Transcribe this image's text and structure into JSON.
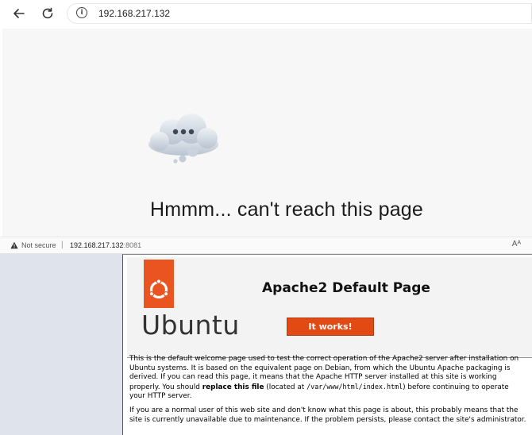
{
  "browser": {
    "url": "192.168.217.132",
    "back_icon": "back-arrow-icon",
    "refresh_icon": "refresh-icon",
    "info_icon": "site-info-icon",
    "info_glyph": "i"
  },
  "error_page": {
    "title": "Hmmm... can't reach this page",
    "illustration_icon": "cloud-error-icon"
  },
  "status_bar": {
    "security_label": "Not secure",
    "separator": "|",
    "host": "192.168.217.132",
    "port": ":8081",
    "read_aloud_label": "Aᴬ"
  },
  "apache_page": {
    "logo_word": "Ubuntu",
    "title": "Apache2 Default Page",
    "banner": "It works!",
    "p1_a": "This is the default welcome page used to test the correct operation of the Apache2 server after installation on Ubuntu systems. It is based on the equivalent page on Debian, from which the Ubuntu Apache packaging is derived. If you can read this page, it means that the Apache HTTP server installed at this site is working properly. You should ",
    "p1_bold": "replace this file",
    "p1_b": " (located at ",
    "p1_path": "/var/www/html/index.html",
    "p1_c": ") before continuing to operate your HTTP server.",
    "p2": "If you are a normal user of this web site and don't know what this page is about, this probably means that the site is currently unavailable due to maintenance. If the problem persists, please contact the site's administrator.",
    "accent_color": "#e95420"
  }
}
